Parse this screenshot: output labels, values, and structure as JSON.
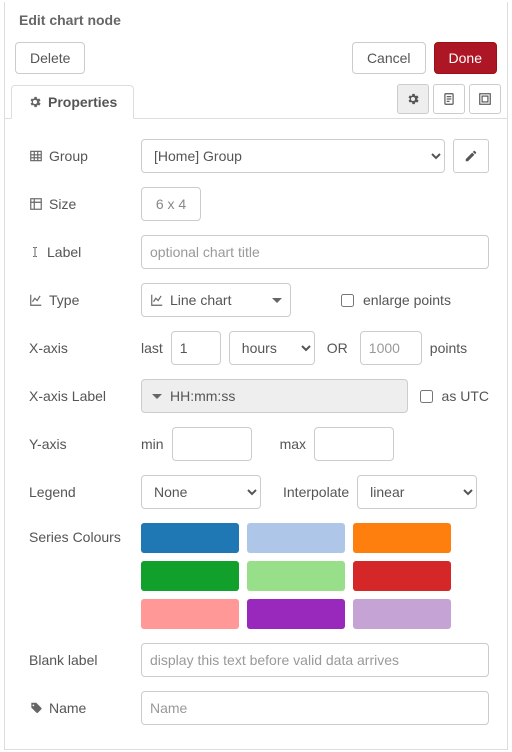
{
  "title": "Edit chart node",
  "buttons": {
    "delete": "Delete",
    "cancel": "Cancel",
    "done": "Done"
  },
  "tab": {
    "properties": "Properties"
  },
  "fields": {
    "group": {
      "label": "Group",
      "value": "[Home] Group"
    },
    "size": {
      "label": "Size",
      "value": "6 x 4"
    },
    "labelf": {
      "label": "Label",
      "placeholder": "optional chart title"
    },
    "type": {
      "label": "Type",
      "value": "Line chart",
      "enlarge": "enlarge points"
    },
    "xaxis": {
      "label": "X-axis",
      "last": "last",
      "val": "1",
      "unit": "hours",
      "or": "OR",
      "pointsPh": "1000",
      "points": "points"
    },
    "xaxislabel": {
      "label": "X-axis Label",
      "value": "HH:mm:ss",
      "utc": "as UTC"
    },
    "yaxis": {
      "label": "Y-axis",
      "min": "min",
      "max": "max"
    },
    "legend": {
      "label": "Legend",
      "value": "None",
      "interp_label": "Interpolate",
      "interp_value": "linear"
    },
    "series": {
      "label": "Series Colours"
    },
    "blank": {
      "label": "Blank label",
      "placeholder": "display this text before valid data arrives"
    },
    "name": {
      "label": "Name",
      "placeholder": "Name"
    }
  },
  "colors": [
    "#1f77b4",
    "#aec7e8",
    "#ff7f0e",
    "#11a02c",
    "#98df8a",
    "#d62728",
    "#ff9896",
    "#9928bd",
    "#c5a4d5"
  ]
}
